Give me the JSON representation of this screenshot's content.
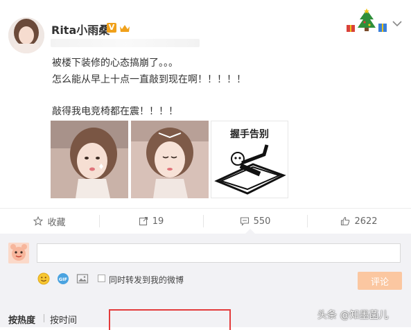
{
  "post": {
    "username": "Rita小雨桑",
    "verified_badge": "V",
    "lines": [
      "被楼下装修的心态搞崩了。。。",
      "怎么能从早上十点一直敲到现在啊！！！！！",
      "敲得我电竞椅都在震！！！！"
    ],
    "meme_caption": "握手告别"
  },
  "actions": {
    "favorite_label": "收藏",
    "repost_count": "19",
    "comment_count": "550",
    "like_count": "2622"
  },
  "comment": {
    "input_value": "",
    "forward_label": "同时转发到我的微博",
    "submit_label": "评论",
    "sort_hot": "按热度",
    "sort_time": "按时间"
  },
  "watermark": "头条 @知墨菡儿",
  "colors": {
    "accent": "#f0a11b",
    "submit_bg": "#fbc7a1",
    "highlight_box": "#e33b3b",
    "comment_bg": "#f2f2f5"
  }
}
